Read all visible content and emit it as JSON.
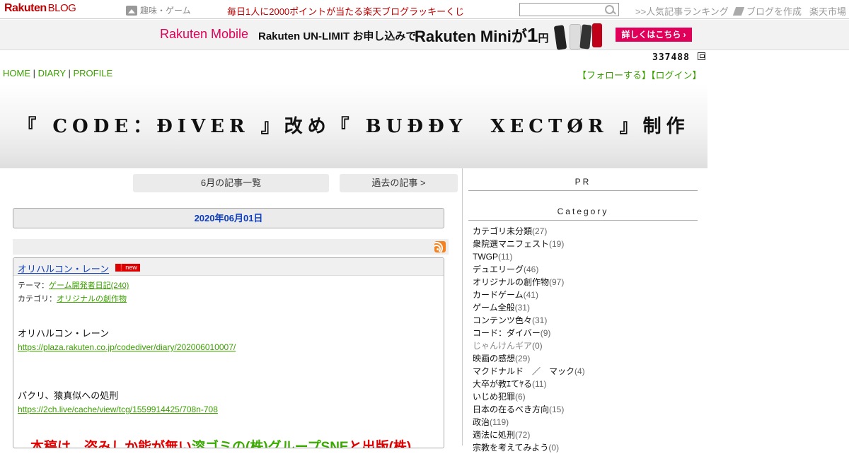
{
  "topbar": {
    "logo": "Rakuten",
    "logo_suffix": "BLOG",
    "hobby": "趣味・ゲーム",
    "lucky": "毎日1人に2000ポイントが当たる楽天ブログラッキーくじ",
    "search_placeholder": "",
    "ranking": ">>人気記事ランキング",
    "create_blog": "ブログを作成",
    "market": "楽天市場"
  },
  "ad": {
    "brand": "Rakuten Mobile",
    "unlimit": "Rakuten UN-LIMIT お申し込みで",
    "mini": "Rakuten Miniが",
    "price_num": "1",
    "price_unit": "円",
    "button": "詳しくはこちら ›",
    "colors": {
      "brand": "#e0005a"
    }
  },
  "counter": "337488",
  "nav": {
    "home": "HOME",
    "diary": "DIARY",
    "profile": "PROFILE",
    "sep": " | "
  },
  "follow": {
    "follow": "【フォローする】",
    "login": "【ログイン】"
  },
  "header": {
    "title": "『 CODE：ĐIVER 』改め『 BUĐĐY　XECTØR 』制作"
  },
  "main": {
    "month_list": "6月の記事一覧",
    "past": "過去の記事 >",
    "date": "2020年06月01日",
    "entry": {
      "title": "オリハルコン・レーン",
      "badge": "new",
      "theme_label": "テーマ：",
      "theme": "ゲーム開発者日記(240)",
      "category_label": "カテゴリ：",
      "category": "オリジナルの創作物",
      "p1": "オリハルコン・レーン",
      "link1": "https://plaza.rakuten.co.jp/codediver/diary/202006010007/",
      "p2": "パクリ、猿真似への処刑",
      "link2": "https://2ch.live/cache/view/tcg/1559914425/708n-708",
      "big_red": "本稿は、盗みしか能が無い",
      "big_green": "溶ゴミの(株)グループSNE",
      "big_red2": "と出版(株)"
    }
  },
  "sidebar": {
    "pr": "PR",
    "category_title": "Category",
    "categories": [
      {
        "name": "カテゴリ未分類",
        "count": "(27)"
      },
      {
        "name": "衆院選マニフェスト",
        "count": "(19)"
      },
      {
        "name": "TWGP",
        "count": "(11)"
      },
      {
        "name": "デュエリーグ",
        "count": "(46)"
      },
      {
        "name": "オリジナルの創作物",
        "count": "(97)"
      },
      {
        "name": "カードゲーム",
        "count": "(41)"
      },
      {
        "name": "ゲーム全般",
        "count": "(31)"
      },
      {
        "name": "コンテンツ色々",
        "count": "(31)"
      },
      {
        "name": "コード：ダイバー",
        "count": "(9)"
      },
      {
        "name": "じゃんけんギア",
        "count": "(0)"
      },
      {
        "name": "映画の感想",
        "count": "(29)"
      },
      {
        "name": "マクドナルド　／　マック",
        "count": "(4)"
      },
      {
        "name": "大卒が教ｴてﾔる",
        "count": "(11)"
      },
      {
        "name": "いじめ犯罪",
        "count": "(6)"
      },
      {
        "name": "日本の在るべき方向",
        "count": "(15)"
      },
      {
        "name": "政治",
        "count": "(119)"
      },
      {
        "name": "適法に処刑",
        "count": "(72)"
      },
      {
        "name": "宗教を考えてみよう",
        "count": "(0)"
      }
    ]
  }
}
